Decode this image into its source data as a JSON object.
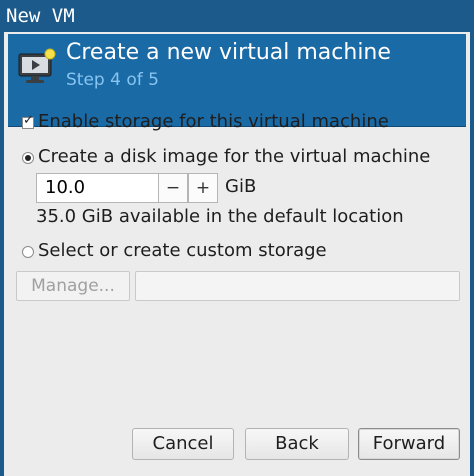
{
  "window": {
    "title": "New VM"
  },
  "header": {
    "title": "Create a new virtual machine",
    "step": "Step 4 of 5",
    "icon": "computer-monitor-icon"
  },
  "storage": {
    "enable_label": "Enable storage for this virtual machine",
    "enable_checked": true,
    "create_disk_label": "Create a disk image for the virtual machine",
    "create_disk_selected": true,
    "size_value": "10.0",
    "decrement_label": "−",
    "increment_label": "+",
    "unit_label": "GiB",
    "available_text": "35.0 GiB available in the default location",
    "custom_label": "Select or create custom storage",
    "custom_selected": false,
    "manage_label": "Manage...",
    "custom_path_value": ""
  },
  "buttons": {
    "cancel": "Cancel",
    "back": "Back",
    "forward": "Forward"
  },
  "colors": {
    "title_bar": "#1d5a8c",
    "header_bg": "#1a6aa6",
    "header_step": "#87c4f0",
    "dialog_bg": "#ececec"
  }
}
